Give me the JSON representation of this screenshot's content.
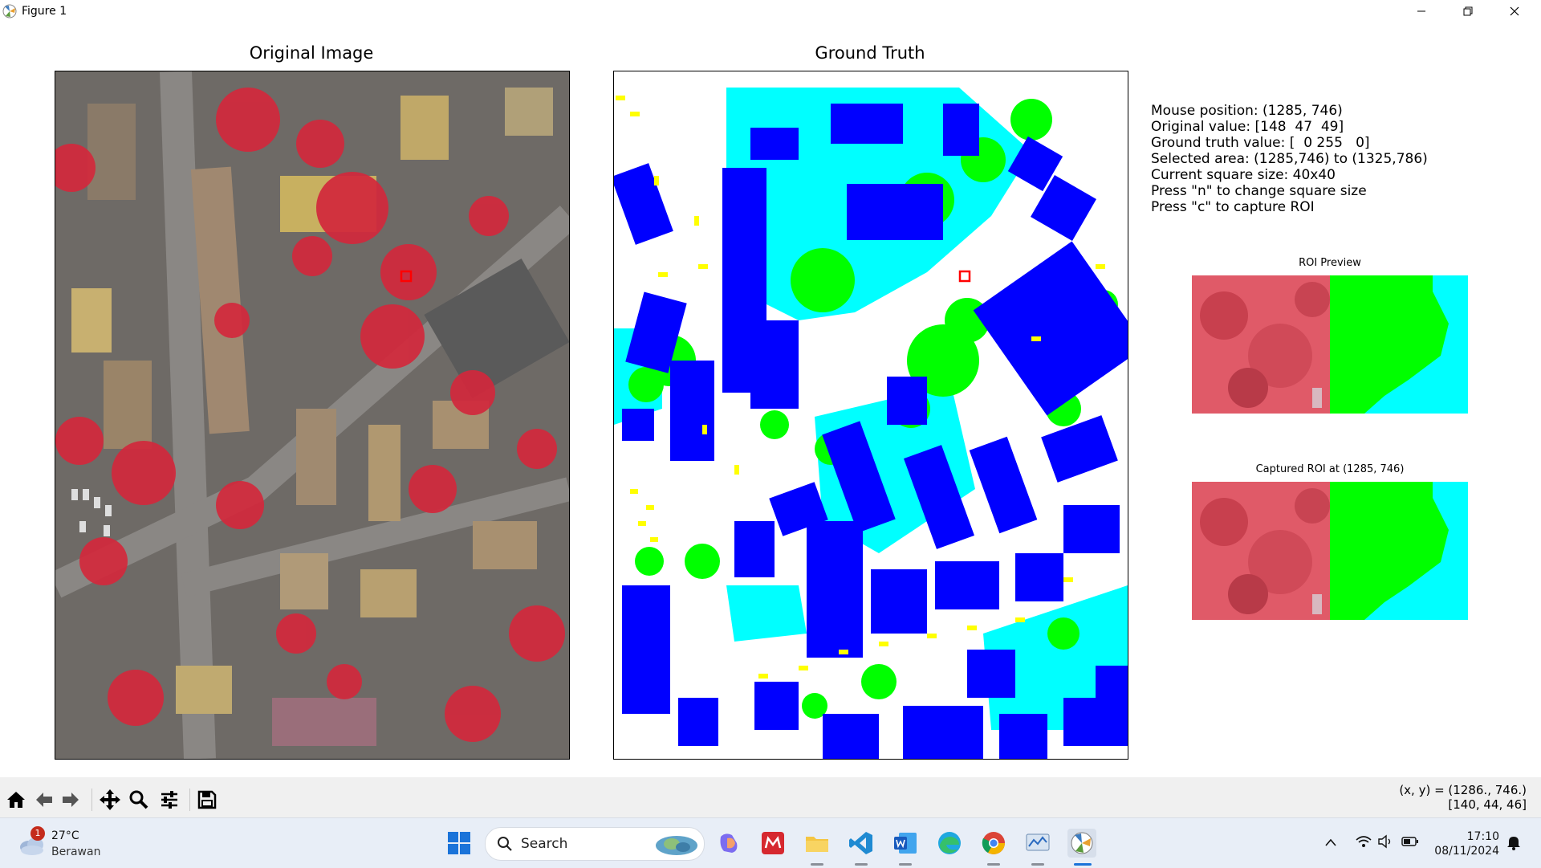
{
  "window": {
    "title": "Figure 1"
  },
  "plots": {
    "original_title": "Original Image",
    "ground_truth_title": "Ground Truth",
    "roi_preview_title": "ROI Preview",
    "captured_title": "Captured ROI at (1285, 746)"
  },
  "info": {
    "mouse_position": "Mouse position: (1285, 746)",
    "original_value": "Original value: [148  47  49]",
    "ground_truth_value": "Ground truth value: [  0 255   0]",
    "selected_area": "Selected area: (1285,746) to (1325,786)",
    "square_size": "Current square size: 40x40",
    "press_n": "Press \"n\" to change square size",
    "press_c": "Press \"c\" to capture ROI"
  },
  "toolbar": {
    "coords_line1": "(x, y) = (1286., 746.)",
    "coords_line2": "[140, 44, 46]"
  },
  "taskbar": {
    "weather_temp": "27°C",
    "weather_cond": "Berawan",
    "weather_badge": "1",
    "search_label": "Search",
    "time": "17:10",
    "date": "08/11/2024"
  },
  "colors": {
    "building": "#0000ff",
    "low_veg": "#00ffff",
    "tree": "#00ff00",
    "car": "#ffff00",
    "surface": "#ffffff",
    "selection": "#ff0000"
  }
}
